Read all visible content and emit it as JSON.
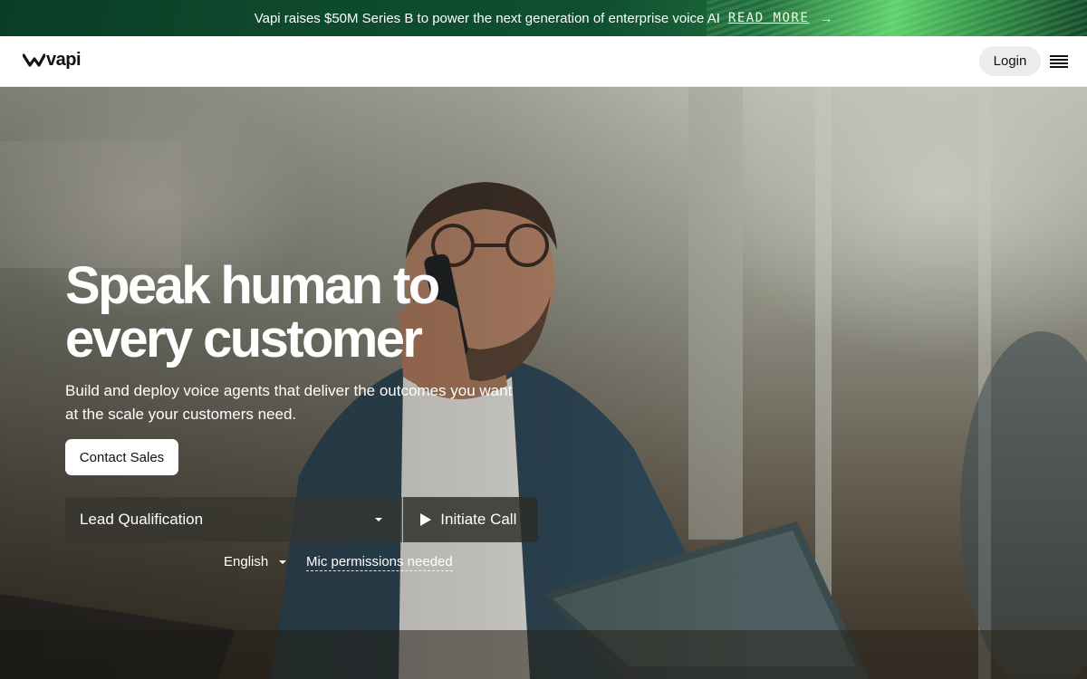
{
  "banner": {
    "text": "Vapi raises $50M Series B to power the next generation of enterprise voice AI",
    "link_label": "READ MORE",
    "arrow": "→",
    "accent_color": "#5bcf6a"
  },
  "nav": {
    "logo_text": "vapi",
    "login_label": "Login",
    "menu_icon": "hamburger-menu-icon"
  },
  "hero": {
    "title": "Speak human to every customer",
    "subtitle": "Build and deploy voice agents that deliver the outcomes you want at the scale your customers need.",
    "contact_label": "Contact Sales",
    "demo": {
      "scenario_value": "Lead Qualification",
      "initiate_label": "Initiate Call",
      "language_value": "English",
      "mic_note": "Mic permissions needed"
    }
  }
}
